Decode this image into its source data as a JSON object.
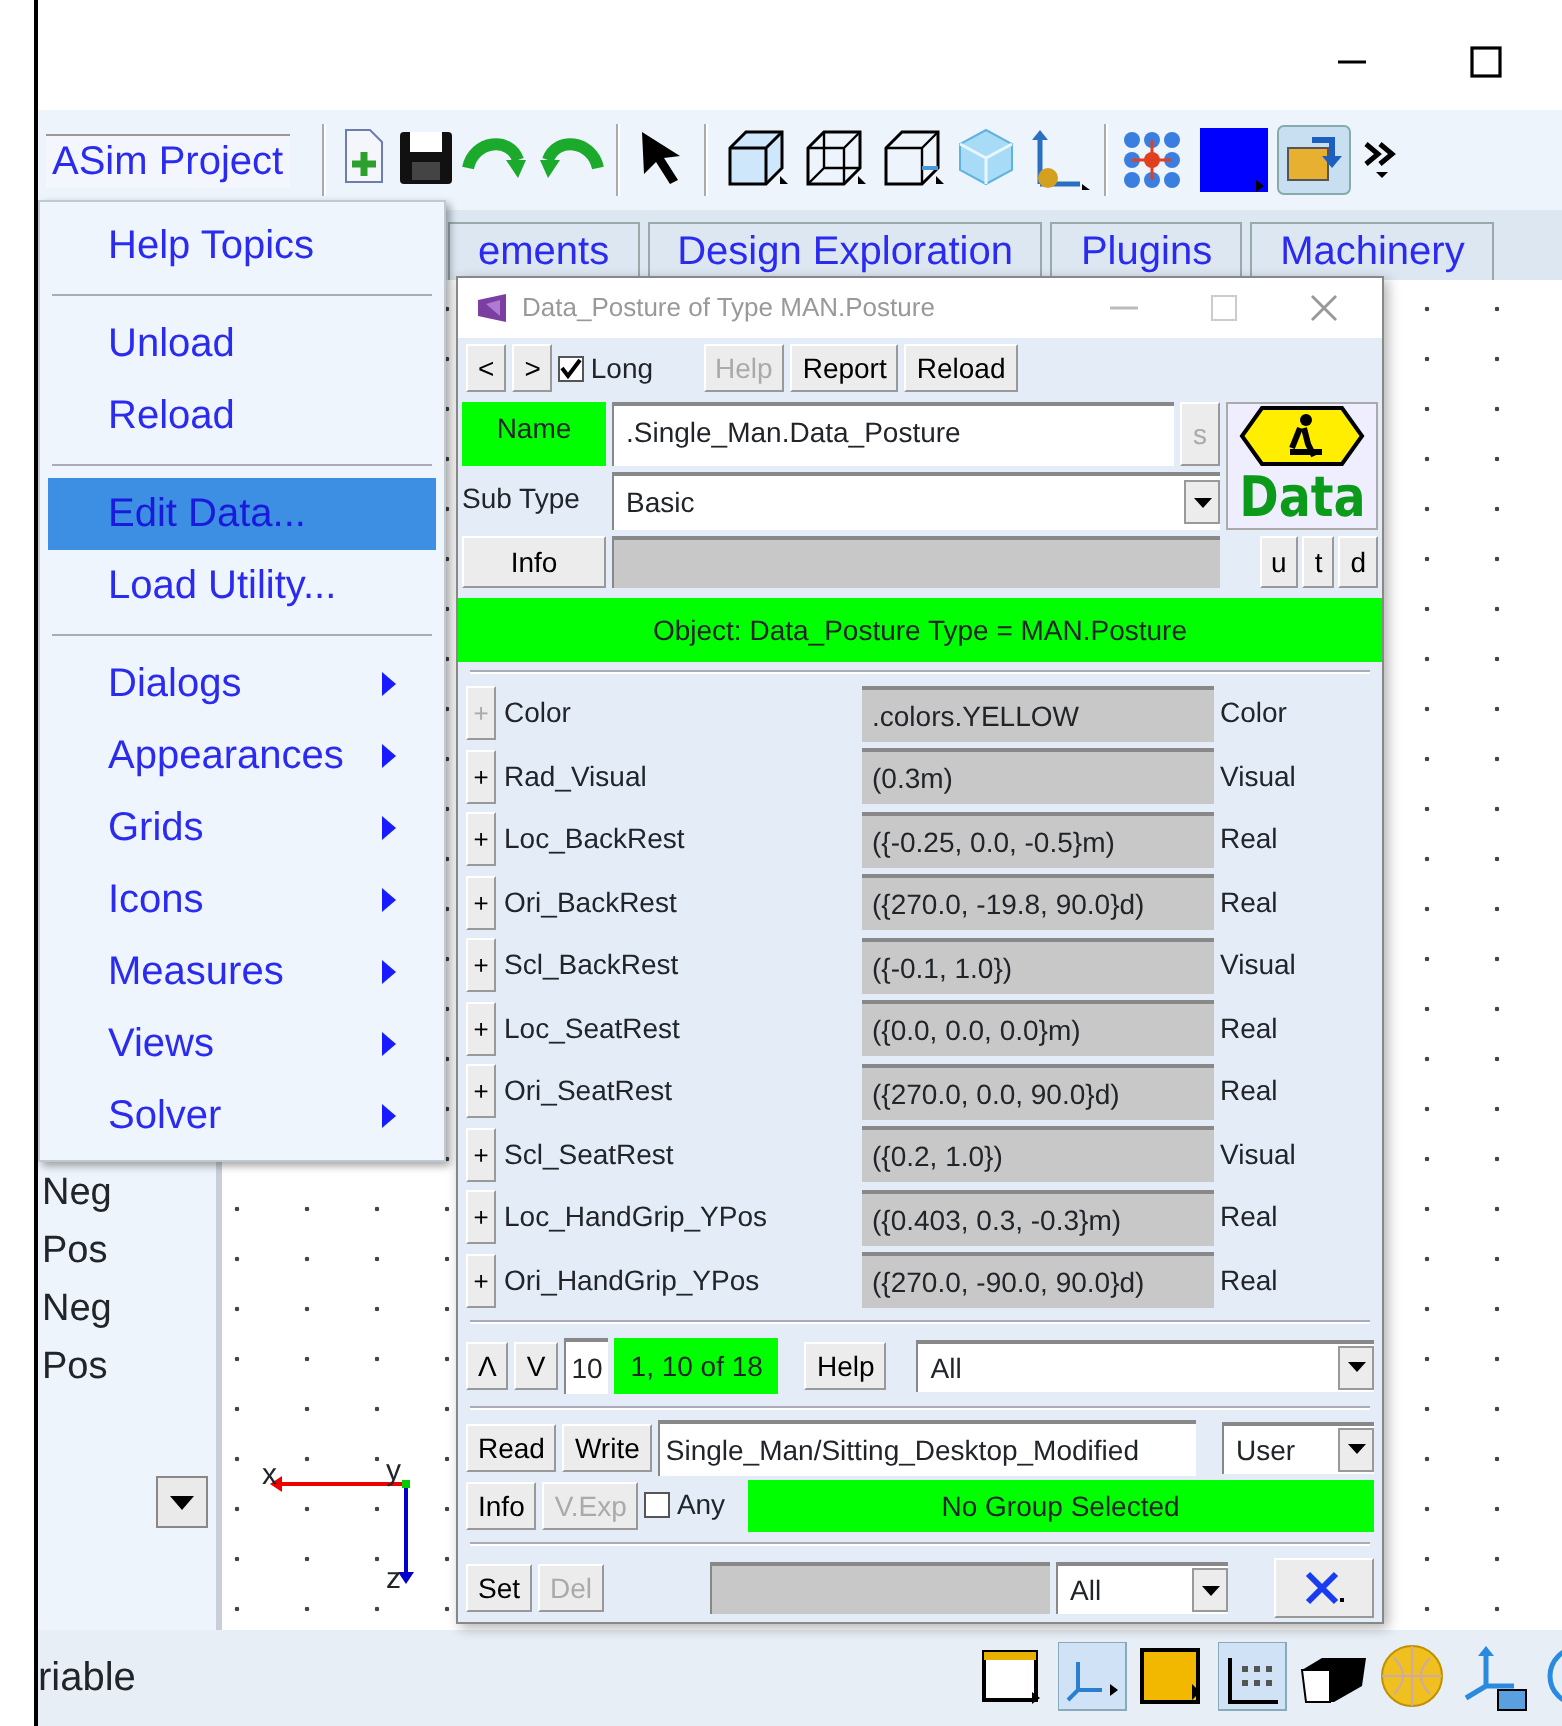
{
  "toolbar": {
    "project": "ASim Project"
  },
  "tabs": [
    {
      "label": "ements",
      "selected": false
    },
    {
      "label": "Design Exploration",
      "selected": false
    },
    {
      "label": "Plugins",
      "selected": false
    },
    {
      "label": "Machinery",
      "selected": false
    }
  ],
  "menu": [
    {
      "kind": "item",
      "label": "Help Topics",
      "selected": false,
      "submenu": false
    },
    {
      "kind": "separator"
    },
    {
      "kind": "item",
      "label": "Unload",
      "selected": false,
      "submenu": false
    },
    {
      "kind": "item",
      "label": "Reload",
      "selected": false,
      "submenu": false
    },
    {
      "kind": "separator"
    },
    {
      "kind": "item",
      "label": "Edit Data...",
      "selected": true,
      "submenu": false
    },
    {
      "kind": "item",
      "label": "Load Utility...",
      "selected": false,
      "submenu": false
    },
    {
      "kind": "separator"
    },
    {
      "kind": "item",
      "label": "Dialogs",
      "selected": false,
      "submenu": true
    },
    {
      "kind": "item",
      "label": "Appearances",
      "selected": false,
      "submenu": true
    },
    {
      "kind": "item",
      "label": "Grids",
      "selected": false,
      "submenu": true
    },
    {
      "kind": "item",
      "label": "Icons",
      "selected": false,
      "submenu": true
    },
    {
      "kind": "item",
      "label": "Measures",
      "selected": false,
      "submenu": true
    },
    {
      "kind": "item",
      "label": "Views",
      "selected": false,
      "submenu": true
    },
    {
      "kind": "item",
      "label": "Solver",
      "selected": false,
      "submenu": true
    }
  ],
  "left_panel": {
    "items": [
      "Neg",
      "Pos",
      "Neg",
      "Pos"
    ]
  },
  "axes": {
    "x": "x",
    "y": "y",
    "z": "z"
  },
  "status_bar": {
    "text": "riable"
  },
  "dialog": {
    "title": "Data_Posture of Type MAN.Posture",
    "toolbar": [
      {
        "kind": "button",
        "label": "<",
        "disabled": false
      },
      {
        "kind": "button",
        "label": ">",
        "disabled": false
      },
      {
        "kind": "checkbox",
        "label": "Long",
        "checked": true
      },
      {
        "kind": "button",
        "label": "Help",
        "disabled": true
      },
      {
        "kind": "button",
        "label": "Report",
        "disabled": false
      },
      {
        "kind": "button",
        "label": "Reload",
        "disabled": false
      }
    ],
    "name": {
      "label": "Name",
      "value": ".Single_Man.Data_Posture",
      "button": {
        "label": "s",
        "disabled": true
      }
    },
    "sub_type": {
      "label": "Sub Type",
      "value": "Basic"
    },
    "info": {
      "button": "Info",
      "flags": [
        "u",
        "t",
        "d"
      ]
    },
    "logo": "Data",
    "object_banner": "Object: Data_Posture Type = MAN.Posture",
    "parameters": [
      {
        "name": "Color",
        "value": ".colors.YELLOW",
        "type": "Color",
        "expand": "+",
        "disabled": true
      },
      {
        "name": "Rad_Visual",
        "value": "(0.3m)",
        "type": "Visual",
        "expand": "+",
        "disabled": false
      },
      {
        "name": "Loc_BackRest",
        "value": "({-0.25, 0.0, -0.5}m)",
        "type": "Real",
        "expand": "+",
        "disabled": false
      },
      {
        "name": "Ori_BackRest",
        "value": "({270.0, -19.8, 90.0}d)",
        "type": "Real",
        "expand": "+",
        "disabled": false
      },
      {
        "name": "Scl_BackRest",
        "value": "({-0.1, 1.0})",
        "type": "Visual",
        "expand": "+",
        "disabled": false
      },
      {
        "name": "Loc_SeatRest",
        "value": "({0.0, 0.0, 0.0}m)",
        "type": "Real",
        "expand": "+",
        "disabled": false
      },
      {
        "name": "Ori_SeatRest",
        "value": "({270.0, 0.0, 90.0}d)",
        "type": "Real",
        "expand": "+",
        "disabled": false
      },
      {
        "name": "Scl_SeatRest",
        "value": "({0.2, 1.0})",
        "type": "Visual",
        "expand": "+",
        "disabled": false
      },
      {
        "name": "Loc_HandGrip_YPos",
        "value": "({0.403, 0.3, -0.3}m)",
        "type": "Real",
        "expand": "+",
        "disabled": false
      },
      {
        "name": "Ori_HandGrip_YPos",
        "value": "({270.0, -90.0, 90.0}d)",
        "type": "Real",
        "expand": "+",
        "disabled": false
      }
    ],
    "pager": {
      "up": "Λ",
      "down": "V",
      "page_size": "10",
      "range": "1, 10 of 18",
      "help": "Help",
      "filter": "All"
    },
    "file": {
      "read": "Read",
      "write": "Write",
      "path": "Single_Man/Sitting_Desktop_Modified",
      "scope": "User"
    },
    "group": {
      "info": "Info",
      "export": {
        "label": "V.Exp",
        "disabled": true
      },
      "any": {
        "label": "Any",
        "checked": false
      },
      "status": "No Group Selected"
    },
    "footer": {
      "set": "Set",
      "delete": {
        "label": "Del",
        "disabled": true
      },
      "filter": "All"
    }
  }
}
